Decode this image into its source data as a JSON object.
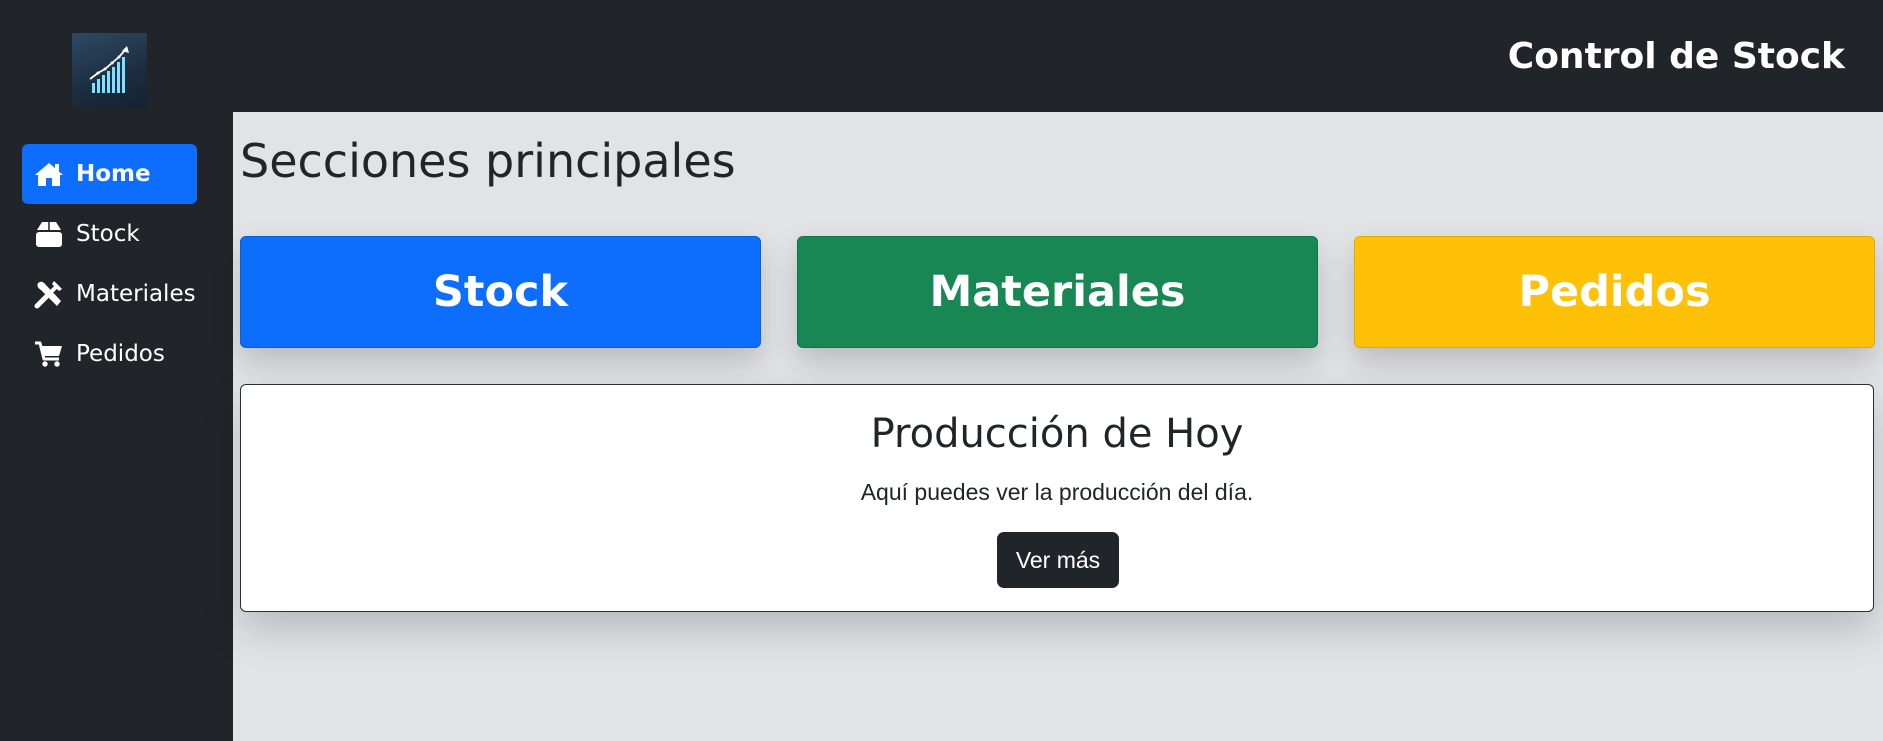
{
  "header": {
    "title": "Control de Stock"
  },
  "logo": {
    "icon": "bar-chart-growth-icon"
  },
  "sidebar": {
    "items": [
      {
        "label": "Home",
        "icon": "home-icon",
        "active": true
      },
      {
        "label": "Stock",
        "icon": "box-icon",
        "active": false
      },
      {
        "label": "Materiales",
        "icon": "tools-icon",
        "active": false
      },
      {
        "label": "Pedidos",
        "icon": "cart-icon",
        "active": false
      }
    ]
  },
  "main": {
    "title": "Secciones principales",
    "sections": [
      {
        "label": "Stock",
        "color": "#0d6efd"
      },
      {
        "label": "Materiales",
        "color": "#198754"
      },
      {
        "label": "Pedidos",
        "color": "#ffc107"
      }
    ],
    "card": {
      "title": "Producción de Hoy",
      "text": "Aquí puedes ver la producción del día.",
      "button_label": "Ver más"
    }
  },
  "colors": {
    "sidebar_bg": "#212529",
    "main_bg": "#e1e3e6",
    "active": "#0d6efd"
  }
}
